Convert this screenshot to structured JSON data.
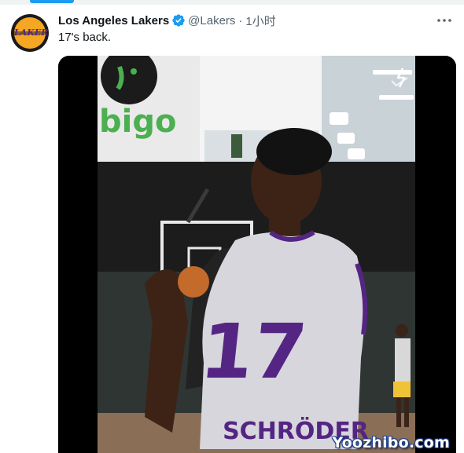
{
  "tweet": {
    "author_name": "Los Angeles Lakers",
    "avatar_text": "LAKERS",
    "handle": "@Lakers",
    "separator": "·",
    "time": "1小时",
    "text": "17's back."
  },
  "media": {
    "wall_sign": "bigo",
    "jersey_number": "17",
    "jersey_name": "SCHRÖDER",
    "watermark": "Yoozhibo.com"
  },
  "colors": {
    "accent": "#1d9bf0",
    "verified": "#1d9bf0",
    "secondary_text": "#536471",
    "lakers_purple": "#552583",
    "lakers_gold": "#f5a623",
    "sign_green": "#4caf50"
  },
  "icons": [
    "verified-badge-icon",
    "more-options-icon",
    "spark-icon"
  ]
}
